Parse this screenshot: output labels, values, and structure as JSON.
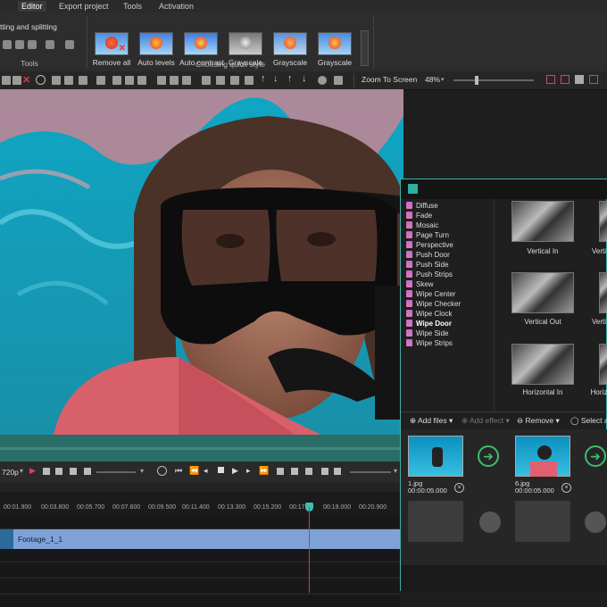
{
  "menu": [
    "Editor",
    "Export project",
    "Tools",
    "Activation"
  ],
  "ribbon": {
    "cut_label": "tting and splitting",
    "tools_label": "Tools",
    "quick_style_label": "Choosing quick style",
    "styles": [
      {
        "label": "Remove all"
      },
      {
        "label": "Auto levels"
      },
      {
        "label": "Auto contrast"
      },
      {
        "label": "Grayscale"
      },
      {
        "label": "Grayscale"
      },
      {
        "label": "Grayscale"
      }
    ]
  },
  "toolbar2": {
    "zoom_label": "Zoom To Screen",
    "zoom_value": "48%"
  },
  "effects_panel": {
    "items": [
      "Diffuse",
      "Fade",
      "Mosaic",
      "Page Turn",
      "Perspective",
      "Push Door",
      "Push Side",
      "Push Strips",
      "Skew",
      "Wipe Center",
      "Wipe Checker",
      "Wipe Clock",
      "Wipe Door",
      "Wipe Side",
      "Wipe Strips"
    ],
    "selected": "Wipe Door",
    "thumbnails": [
      "Vertical In",
      "Verti",
      "Vertical Out",
      "Verti",
      "Horizontal In",
      "Horiz"
    ],
    "buttons": {
      "add_files": "Add files",
      "add_effect": "Add effect",
      "remove": "Remove",
      "select_all": "Select al"
    },
    "slides": [
      {
        "name": "1.jpg",
        "duration": "00:00:05.000"
      },
      {
        "name": "6.jpg",
        "duration": "00:00:05.000"
      }
    ]
  },
  "controls": {
    "resolution": "720p"
  },
  "timeline": {
    "ticks": [
      "00:01.900",
      "00:03.800",
      "00:05.700",
      "00:07.600",
      "00:09.500",
      "00:11.400",
      "00:13.300",
      "00:15.200",
      "00:17",
      "00:19.000",
      "00:20.900"
    ],
    "clip_label": "Footage_1_1"
  }
}
